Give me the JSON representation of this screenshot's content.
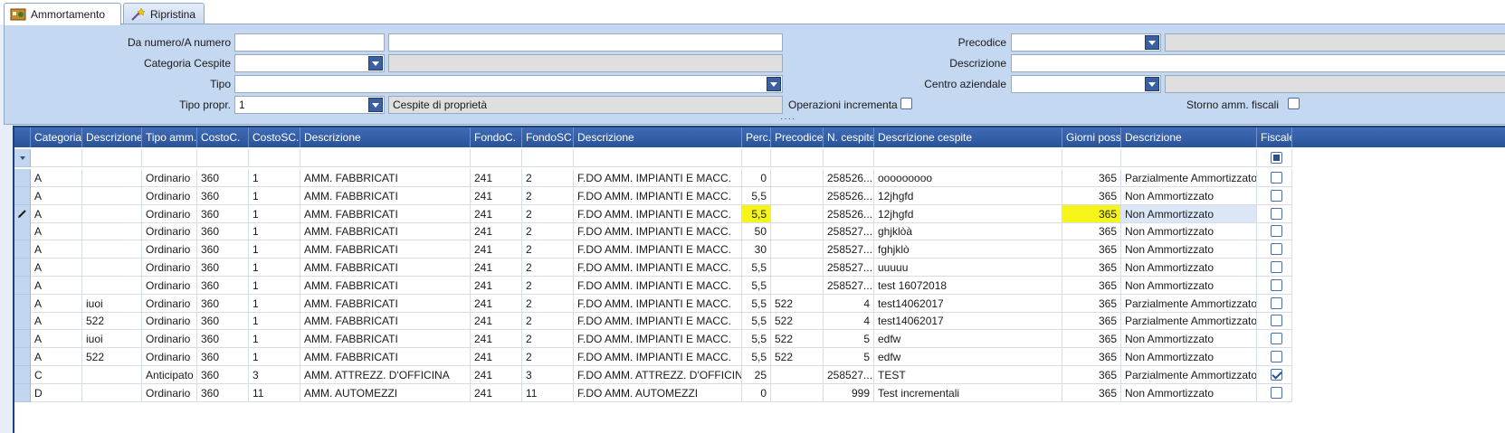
{
  "tabs": [
    {
      "label": "Ammortamento",
      "active": true,
      "icon": "depreciation-icon"
    },
    {
      "label": "Ripristina",
      "active": false,
      "icon": "restore-wand-icon"
    }
  ],
  "filters": {
    "da_numero_label": "Da numero/A numero",
    "categoria_label": "Categoria Cespite",
    "tipo_label": "Tipo",
    "tipo_propr_label": "Tipo propr.",
    "tipo_propr_value": "1",
    "tipo_propr_desc": "Cespite di proprietà",
    "operazioni_label": "Operazioni incrementa",
    "precodice_label": "Precodice",
    "descrizione_label": "Descrizione",
    "centro_label": "Centro aziendale",
    "storno_label": "Storno amm. fiscali",
    "splitter": "····"
  },
  "grid": {
    "columns": [
      "Categoria",
      "Descrizione",
      "Tipo amm.",
      "CostoC.",
      "CostoSC.",
      "Descrizione",
      "FondoC.",
      "FondoSC.",
      "Descrizione",
      "Perc.",
      "Precodice",
      "N. cespite",
      "Descrizione cespite",
      "Giorni poss.",
      "Descrizione",
      "Fiscale"
    ],
    "rows": [
      [
        "A",
        "",
        "Ordinario",
        "360",
        "1",
        "AMM. FABBRICATI",
        "241",
        "2",
        "F.DO AMM. IMPIANTI E MACC.",
        "0",
        "",
        "258526...",
        "ooooooooo",
        "365",
        "Parzialmente Ammortizzato",
        false
      ],
      [
        "A",
        "",
        "Ordinario",
        "360",
        "1",
        "AMM. FABBRICATI",
        "241",
        "2",
        "F.DO AMM. IMPIANTI E MACC.",
        "5,5",
        "",
        "258526...",
        "12jhgfd",
        "365",
        "Non Ammortizzato",
        false
      ],
      [
        "A",
        "",
        "Ordinario",
        "360",
        "1",
        "AMM. FABBRICATI",
        "241",
        "2",
        "F.DO AMM. IMPIANTI E MACC.",
        "5,5",
        "",
        "258526...",
        "12jhgfd",
        "365",
        "Non Ammortizzato",
        false
      ],
      [
        "A",
        "",
        "Ordinario",
        "360",
        "1",
        "AMM. FABBRICATI",
        "241",
        "2",
        "F.DO AMM. IMPIANTI E MACC.",
        "50",
        "",
        "258527...",
        "ghjklòà",
        "365",
        "Non Ammortizzato",
        false
      ],
      [
        "A",
        "",
        "Ordinario",
        "360",
        "1",
        "AMM. FABBRICATI",
        "241",
        "2",
        "F.DO AMM. IMPIANTI E MACC.",
        "30",
        "",
        "258527...",
        "fghjklò",
        "365",
        "Non Ammortizzato",
        false
      ],
      [
        "A",
        "",
        "Ordinario",
        "360",
        "1",
        "AMM. FABBRICATI",
        "241",
        "2",
        "F.DO AMM. IMPIANTI E MACC.",
        "5,5",
        "",
        "258527...",
        "uuuuu",
        "365",
        "Non Ammortizzato",
        false
      ],
      [
        "A",
        "",
        "Ordinario",
        "360",
        "1",
        "AMM. FABBRICATI",
        "241",
        "2",
        "F.DO AMM. IMPIANTI E MACC.",
        "5,5",
        "",
        "258527...",
        "test 16072018",
        "365",
        "Non Ammortizzato",
        false
      ],
      [
        "A",
        "iuoi",
        "Ordinario",
        "360",
        "1",
        "AMM. FABBRICATI",
        "241",
        "2",
        "F.DO AMM. IMPIANTI E MACC.",
        "5,5",
        "522",
        "4",
        "test14062017",
        "365",
        "Parzialmente Ammortizzato",
        false
      ],
      [
        "A",
        "522",
        "Ordinario",
        "360",
        "1",
        "AMM. FABBRICATI",
        "241",
        "2",
        "F.DO AMM. IMPIANTI E MACC.",
        "5,5",
        "522",
        "4",
        "test14062017",
        "365",
        "Parzialmente Ammortizzato",
        false
      ],
      [
        "A",
        "iuoi",
        "Ordinario",
        "360",
        "1",
        "AMM. FABBRICATI",
        "241",
        "2",
        "F.DO AMM. IMPIANTI E MACC.",
        "5,5",
        "522",
        "5",
        "edfw",
        "365",
        "Non Ammortizzato",
        false
      ],
      [
        "A",
        "522",
        "Ordinario",
        "360",
        "1",
        "AMM. FABBRICATI",
        "241",
        "2",
        "F.DO AMM. IMPIANTI E MACC.",
        "5,5",
        "522",
        "5",
        "edfw",
        "365",
        "Non Ammortizzato",
        false
      ],
      [
        "C",
        "",
        "Anticipato",
        "360",
        "3",
        "AMM. ATTREZZ. D'OFFICINA",
        "241",
        "3",
        "F.DO AMM. ATTREZZ. D'OFFICINA",
        "25",
        "",
        "258527...",
        "TEST",
        "365",
        "Parzialmente Ammortizzato",
        true
      ],
      [
        "D",
        "",
        "Ordinario",
        "360",
        "11",
        "AMM. AUTOMEZZI",
        "241",
        "11",
        "F.DO AMM. AUTOMEZZI",
        "0",
        "",
        "999",
        "Test incrementali",
        "365",
        "Non Ammortizzato",
        false
      ]
    ],
    "editing_row_index": 2,
    "highlight_color": "#f5f51a"
  }
}
